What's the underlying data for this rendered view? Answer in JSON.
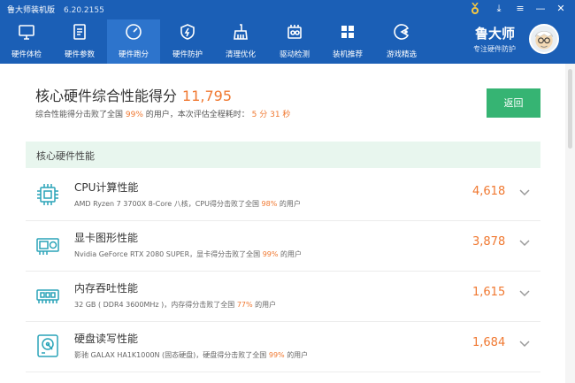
{
  "app": {
    "title": "鲁大师装机版",
    "version": "6.20.2155"
  },
  "tabs": [
    {
      "label": "硬件体检",
      "icon": "monitor-icon"
    },
    {
      "label": "硬件参数",
      "icon": "document-icon"
    },
    {
      "label": "硬件跑分",
      "icon": "speedometer-icon",
      "active": true
    },
    {
      "label": "硬件防护",
      "icon": "shield-icon"
    },
    {
      "label": "清理优化",
      "icon": "broom-icon"
    },
    {
      "label": "驱动检测",
      "icon": "chip-icon"
    },
    {
      "label": "装机推荐",
      "icon": "grid-icon"
    },
    {
      "label": "游戏精选",
      "icon": "pacman-icon"
    }
  ],
  "brand": {
    "name": "鲁大师",
    "tagline": "专注硬件防护"
  },
  "score": {
    "title": "核心硬件综合性能得分",
    "value": "11,795",
    "sub_prefix": "综合性能得分击败了全国",
    "sub_percent": "99%",
    "sub_mid": "的用户，本次评估全程耗时：",
    "sub_time": "5 分 31 秒"
  },
  "back_button": "返回",
  "section_title": "核心硬件性能",
  "items": [
    {
      "name": "CPU计算性能",
      "desc_prefix": "AMD Ryzen 7 3700X 8-Core 八核，CPU得分击败了全国",
      "percent": "98%",
      "desc_suffix": "的用户",
      "score": "4,618",
      "icon": "cpu-icon"
    },
    {
      "name": "显卡图形性能",
      "desc_prefix": "Nvidia GeForce RTX 2080 SUPER，显卡得分击败了全国",
      "percent": "99%",
      "desc_suffix": "的用户",
      "score": "3,878",
      "icon": "graphics-card-icon"
    },
    {
      "name": "内存吞吐性能",
      "desc_prefix": "32 GB ( DDR4 3600MHz )，内存得分击败了全国",
      "percent": "77%",
      "desc_suffix": "的用户",
      "score": "1,615",
      "icon": "memory-icon"
    },
    {
      "name": "硬盘读写性能",
      "desc_prefix": "影驰 GALAX HA1K1000N (固态硬盘)，硬盘得分击败了全国",
      "percent": "99%",
      "desc_suffix": "的用户",
      "score": "1,684",
      "icon": "disk-icon"
    }
  ],
  "colors": {
    "header": "#1b5fb6",
    "accent_orange": "#f07830",
    "green": "#36b473",
    "section_bg": "#e8f6ee"
  }
}
